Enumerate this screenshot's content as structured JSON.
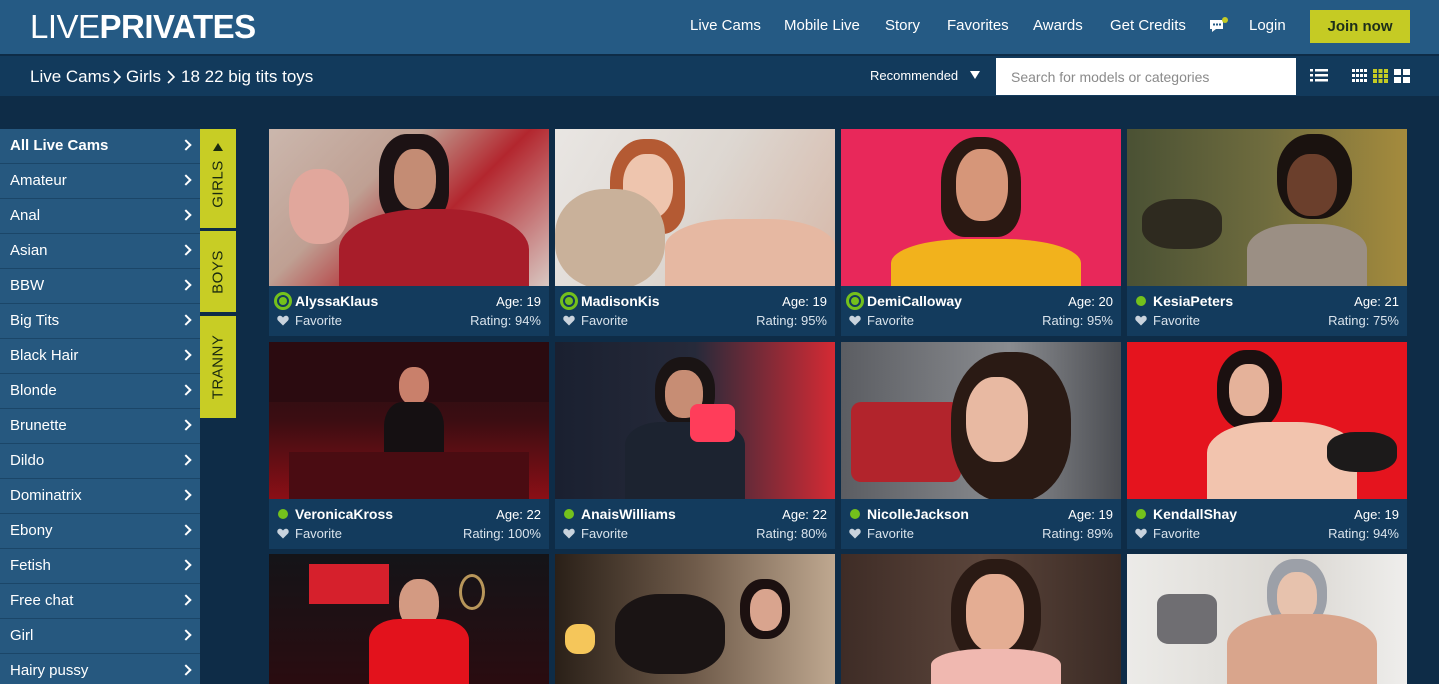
{
  "header": {
    "logo_light": "LIVE",
    "logo_bold": "PRIVATES",
    "nav": [
      "Live Cams",
      "Mobile Live",
      "Story",
      "Favorites",
      "Awards",
      "Get Credits"
    ],
    "login": "Login",
    "join": "Join now"
  },
  "breadcrumb": [
    "Live Cams",
    "Girls",
    "18 22 big tits toys"
  ],
  "sort": {
    "selected": "Recommended"
  },
  "search": {
    "placeholder": "Search for models or categories"
  },
  "sidebar": {
    "items": [
      "All Live Cams",
      "Amateur",
      "Anal",
      "Asian",
      "BBW",
      "Big Tits",
      "Black Hair",
      "Blonde",
      "Brunette",
      "Dildo",
      "Dominatrix",
      "Ebony",
      "Fetish",
      "Free chat",
      "Girl",
      "Hairy pussy"
    ]
  },
  "gender_tabs": [
    "GIRLS",
    "BOYS",
    "TRANNY"
  ],
  "favorite_label": "Favorite",
  "models": [
    {
      "name": "AlyssaKlaus",
      "age": "Age: 19",
      "rating": "Rating: 94%"
    },
    {
      "name": "MadisonKis",
      "age": "Age: 19",
      "rating": "Rating: 95%"
    },
    {
      "name": "DemiCalloway",
      "age": "Age: 20",
      "rating": "Rating: 95%"
    },
    {
      "name": "KesiaPeters",
      "age": "Age: 21",
      "rating": "Rating: 75%"
    },
    {
      "name": "VeronicaKross",
      "age": "Age: 22",
      "rating": "Rating: 100%"
    },
    {
      "name": "AnaisWilliams",
      "age": "Age: 22",
      "rating": "Rating: 80%"
    },
    {
      "name": "NicolleJackson",
      "age": "Age: 19",
      "rating": "Rating: 89%"
    },
    {
      "name": "KendallShay",
      "age": "Age: 19",
      "rating": "Rating: 94%"
    }
  ],
  "colors": {
    "topbar": "#255a84",
    "accent": "#c5cb24",
    "online": "#74c11c",
    "background": "#0e2c47"
  }
}
